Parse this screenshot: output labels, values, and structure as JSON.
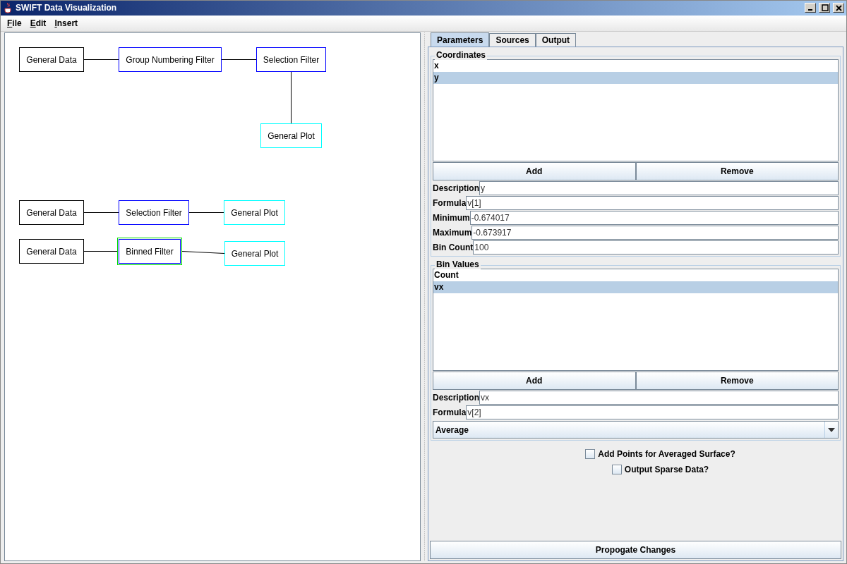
{
  "window": {
    "title": "SWIFT Data Visualization"
  },
  "menu": [
    {
      "label": "File"
    },
    {
      "label": "Edit"
    },
    {
      "label": "Insert"
    }
  ],
  "diagram": {
    "nodes": [
      {
        "label": "General Data",
        "color": "#000000",
        "selected": false
      },
      {
        "label": "Group Numbering Filter",
        "color": "#0000ff",
        "selected": false
      },
      {
        "label": "Selection Filter",
        "color": "#0000ff",
        "selected": false
      },
      {
        "label": "General Plot",
        "color": "#00ffff",
        "selected": false
      },
      {
        "label": "General Data",
        "color": "#000000",
        "selected": false
      },
      {
        "label": "Selection Filter",
        "color": "#0000ff",
        "selected": false
      },
      {
        "label": "General Plot",
        "color": "#00ffff",
        "selected": false
      },
      {
        "label": "General Data",
        "color": "#000000",
        "selected": false
      },
      {
        "label": "Binned Filter",
        "color": "#0000ff",
        "selected": true
      },
      {
        "label": "General Plot",
        "color": "#00ffff",
        "selected": false
      }
    ]
  },
  "tabs": [
    {
      "label": "Parameters",
      "selected": true
    },
    {
      "label": "Sources",
      "selected": false
    },
    {
      "label": "Output",
      "selected": false
    }
  ],
  "coordinates": {
    "title": "Coordinates",
    "items": [
      {
        "label": "x",
        "selected": false
      },
      {
        "label": "y",
        "selected": true
      }
    ],
    "buttons": [
      "Add",
      "Remove"
    ],
    "fields": [
      {
        "label": "Description",
        "value": "y"
      },
      {
        "label": "Formula",
        "value": "v[1]"
      },
      {
        "label": "Minimum",
        "value": "-0.674017"
      },
      {
        "label": "Maximum",
        "value": "-0.673917"
      },
      {
        "label": "Bin Count",
        "value": "100"
      }
    ]
  },
  "bin_values": {
    "title": "Bin Values",
    "items": [
      {
        "label": "Count",
        "selected": false
      },
      {
        "label": "vx",
        "selected": true
      }
    ],
    "buttons": [
      "Add",
      "Remove"
    ],
    "fields": [
      {
        "label": "Description",
        "value": "vx"
      },
      {
        "label": "Formula",
        "value": "v[2]"
      }
    ],
    "dropdown": {
      "value": "Average"
    }
  },
  "checkboxes": [
    {
      "label": "Add Points for Averaged Surface?",
      "checked": false
    },
    {
      "label": "Output Sparse Data?",
      "checked": false
    }
  ],
  "propagate_button": "Propogate Changes"
}
